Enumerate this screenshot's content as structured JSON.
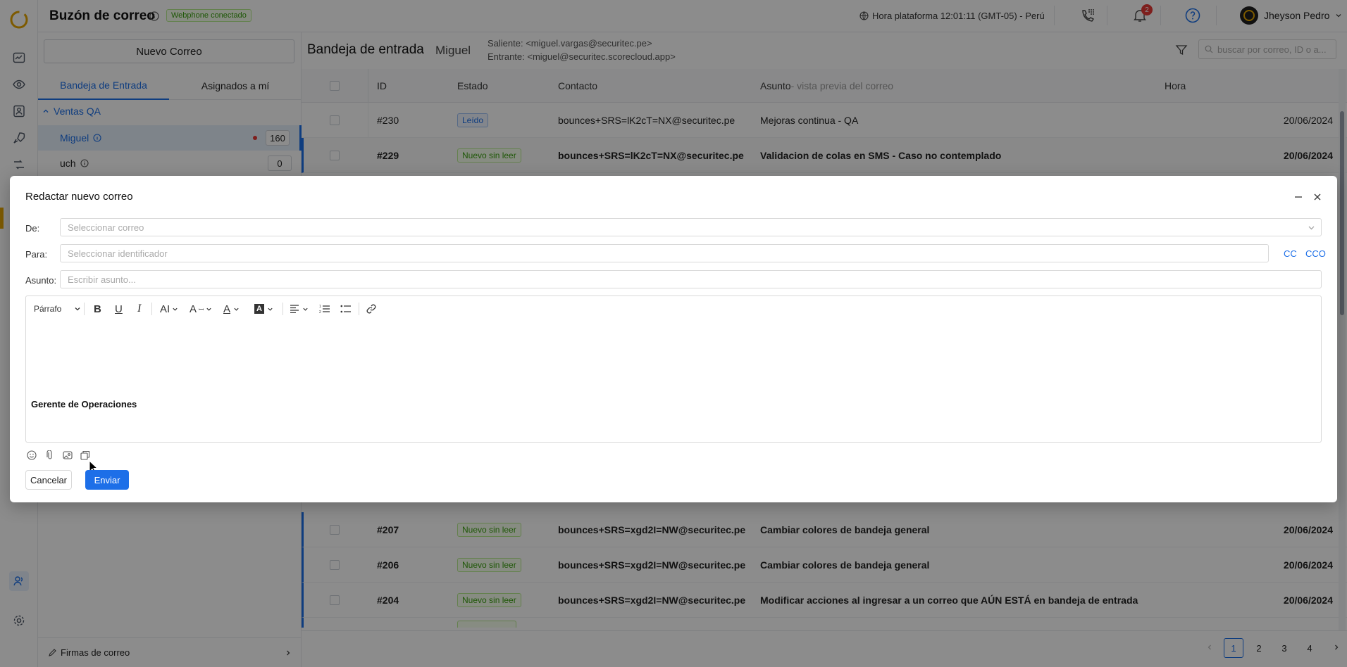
{
  "app": {
    "title": "Buzón de correo",
    "webphone_badge": "Webphone conectado",
    "platform_time": "Hora plataforma 12:01:11 (GMT-05) - Perú",
    "notifications_count": "2",
    "user_name": "Jheyson Pedro"
  },
  "sidebar": {
    "new_mail_label": "Nuevo Correo",
    "tabs": [
      "Bandeja de Entrada",
      "Asignados a mí"
    ],
    "group_label": "Ventas QA",
    "mailboxes": [
      {
        "label": "Miguel",
        "count": "160"
      },
      {
        "label": "uch",
        "count": "0"
      }
    ],
    "signatures_label": "Firmas de correo"
  },
  "inbox": {
    "title": "Bandeja de entrada",
    "mailbox_name": "Miguel",
    "outgoing": "Saliente: <miguel.vargas@securitec.pe>",
    "incoming": "Entrante: <miguel@securitec.scorecloud.app>",
    "search_placeholder": "buscar por correo, ID o a...",
    "columns": {
      "id": "ID",
      "status": "Estado",
      "contact": "Contacto",
      "subject": "Asunto",
      "subject_hint": " - vista previa del correo",
      "time": "Hora"
    },
    "rows_top": [
      {
        "id": "#230",
        "status": "Leído",
        "contact": "bounces+SRS=lK2cT=NX@securitec.pe",
        "subject": "Mejoras continua - QA",
        "time": "20/06/2024"
      },
      {
        "id": "#229",
        "status": "Nuevo sin leer",
        "contact": "bounces+SRS=lK2cT=NX@securitec.pe",
        "subject": "Validacion de colas en SMS - Caso no contemplado",
        "time": "20/06/2024"
      }
    ],
    "rows_bottom": [
      {
        "id": "#207",
        "status": "Nuevo sin leer",
        "contact": "bounces+SRS=xgd2I=NW@securitec.pe",
        "subject": "Cambiar colores de bandeja general",
        "time": "20/06/2024"
      },
      {
        "id": "#206",
        "status": "Nuevo sin leer",
        "contact": "bounces+SRS=xgd2I=NW@securitec.pe",
        "subject": "Cambiar colores de bandeja general",
        "time": "20/06/2024"
      },
      {
        "id": "#204",
        "status": "Nuevo sin leer",
        "contact": "bounces+SRS=xgd2I=NW@securitec.pe",
        "subject": "Modificar acciones al ingresar a un correo que AÚN ESTÁ en bandeja de entrada",
        "time": "20/06/2024"
      }
    ],
    "pagination": [
      "1",
      "2",
      "3",
      "4"
    ],
    "current_page": "1"
  },
  "compose": {
    "title": "Redactar nuevo correo",
    "from_label": "De:",
    "from_placeholder": "Seleccionar correo",
    "to_label": "Para:",
    "to_placeholder": "Seleccionar identificador",
    "cc_label": "CC",
    "bcc_label": "CCO",
    "subject_label": "Asunto:",
    "subject_placeholder": "Escribir asunto...",
    "paragraph_style": "Párrafo",
    "body_signature": "Gerente de Operaciones",
    "cancel_label": "Cancelar",
    "send_label": "Enviar"
  },
  "colors": {
    "accent": "#1d6fe8",
    "brand": "#e3a500",
    "tag_new": "#389e0d",
    "tag_read": "#1d6fe8"
  }
}
